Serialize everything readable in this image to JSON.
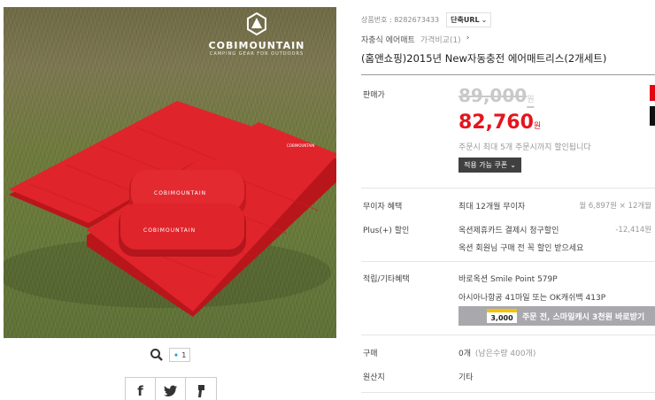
{
  "photo": {
    "brand_name": "COBIMOUNTAIN",
    "brand_tagline": "CAMPING GEAR FOR OUTDOORS",
    "mat_colors": {
      "mat": "#e0242b",
      "mat_dark": "#b9161c",
      "mat_shadow": "#8f1014"
    }
  },
  "photo_toolbar": {
    "zoom_icon": "magnifier-icon",
    "like_count": "1",
    "like_icon": "plus-icon"
  },
  "share": {
    "facebook": "f",
    "twitter": "twitter-bird-icon",
    "story": "story-icon"
  },
  "product": {
    "code_label": "상품번호 : 8282673433",
    "short_url_label": "단축URL",
    "category": "자충식 에어매트",
    "compare_label": "가격비교(1)",
    "title": "(홈앤쇼핑)2015년 New자동충전 에어매트리스(2개세트)"
  },
  "price": {
    "label": "판매가",
    "original": "89,000",
    "won": "원",
    "sale": "82,760",
    "note": "주문시 최대 5개 주문시까지 할인됩니다",
    "coupon_button": "적용 가능 쿠폰"
  },
  "benefits": {
    "installment_label": "무이자 혜택",
    "installment_value": "최대 12개월 무이자",
    "installment_amount": "월 6,897원 × 12개월",
    "plus_label": "Plus(+) 할인",
    "plus_value": "옥션제휴카드 결제시 청구할인",
    "plus_amount": "-12,414원",
    "plus_value2": "옥션 회원님 구매 전 꼭 할인 받으세요",
    "points_label": "적립/기타혜택",
    "points_value1": "바로옥션 Smile Point 579P",
    "points_value2": "아시아나항공 41마일 또는 OK캐쉬백 413P",
    "smile_cash_amount": "3,000",
    "smile_cash_text": "주문 전, 스마일캐시 3천원 바로받기"
  },
  "purchase": {
    "buy_label": "구매",
    "buy_count": "0개",
    "buy_remaining": "(남은수량 400개)",
    "origin_label": "원산지",
    "origin_value": "기타"
  },
  "colors": {
    "sale_red": "#e4151f",
    "side_badge_red": "#e30613"
  }
}
